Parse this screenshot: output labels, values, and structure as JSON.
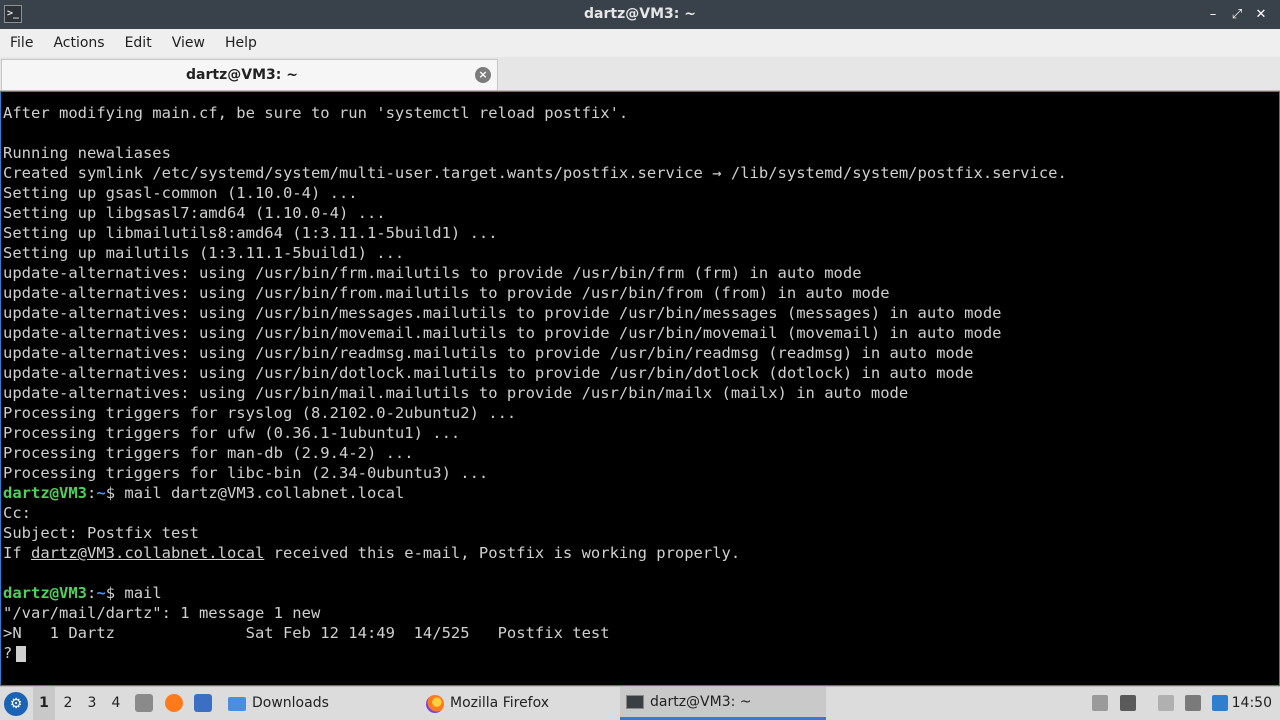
{
  "window": {
    "title": "dartz@VM3: ~",
    "buttons": {
      "minimize": "–",
      "maximize": "⤢",
      "close": "✕"
    }
  },
  "menu": [
    "File",
    "Actions",
    "Edit",
    "View",
    "Help"
  ],
  "tab": {
    "label": "dartz@VM3: ~",
    "close": "×"
  },
  "terminal": {
    "lines": [
      {
        "text": "After modifying main.cf, be sure to run 'systemctl reload postfix'."
      },
      {
        "text": ""
      },
      {
        "text": "Running newaliases"
      },
      {
        "text": "Created symlink /etc/systemd/system/multi-user.target.wants/postfix.service → /lib/systemd/system/postfix.service."
      },
      {
        "text": "Setting up gsasl-common (1.10.0-4) ..."
      },
      {
        "text": "Setting up libgsasl7:amd64 (1.10.0-4) ..."
      },
      {
        "text": "Setting up libmailutils8:amd64 (1:3.11.1-5build1) ..."
      },
      {
        "text": "Setting up mailutils (1:3.11.1-5build1) ..."
      },
      {
        "text": "update-alternatives: using /usr/bin/frm.mailutils to provide /usr/bin/frm (frm) in auto mode"
      },
      {
        "text": "update-alternatives: using /usr/bin/from.mailutils to provide /usr/bin/from (from) in auto mode"
      },
      {
        "text": "update-alternatives: using /usr/bin/messages.mailutils to provide /usr/bin/messages (messages) in auto mode"
      },
      {
        "text": "update-alternatives: using /usr/bin/movemail.mailutils to provide /usr/bin/movemail (movemail) in auto mode"
      },
      {
        "text": "update-alternatives: using /usr/bin/readmsg.mailutils to provide /usr/bin/readmsg (readmsg) in auto mode"
      },
      {
        "text": "update-alternatives: using /usr/bin/dotlock.mailutils to provide /usr/bin/dotlock (dotlock) in auto mode"
      },
      {
        "text": "update-alternatives: using /usr/bin/mail.mailutils to provide /usr/bin/mailx (mailx) in auto mode"
      },
      {
        "text": "Processing triggers for rsyslog (8.2102.0-2ubuntu2) ..."
      },
      {
        "text": "Processing triggers for ufw (0.36.1-1ubuntu1) ..."
      },
      {
        "text": "Processing triggers for man-db (2.9.4-2) ..."
      },
      {
        "text": "Processing triggers for libc-bin (2.34-0ubuntu3) ..."
      }
    ],
    "prompt_user": "dartz@VM3",
    "prompt_path": "~",
    "prompt_sep": ":",
    "prompt_sign": "$",
    "cmd1": " mail dartz@VM3.collabnet.local",
    "cc_line": "Cc:",
    "subject_line": "Subject: Postfix test",
    "body_prefix": "If ",
    "body_address": "dartz@VM3.collabnet.local",
    "body_suffix": " received this e-mail, Postfix is working properly.",
    "blank": "",
    "cmd2": " mail",
    "mailbox_line": "\"/var/mail/dartz\": 1 message 1 new",
    "message_line": ">N   1 Dartz              Sat Feb 12 14:49  14/525   Postfix test",
    "input_prompt": "?"
  },
  "taskbar": {
    "workspaces": [
      "1",
      "2",
      "3",
      "4"
    ],
    "tasks": [
      {
        "label": "Downloads",
        "icon": "folder-icon"
      },
      {
        "label": "Mozilla Firefox",
        "icon": "firefox-icon"
      },
      {
        "label": "dartz@VM3: ~",
        "icon": "terminal-icon"
      }
    ],
    "clock": "14:50",
    "colors": {
      "accent": "#2f7fd1",
      "prompt": "#4fd05a",
      "path": "#4f8ef7"
    }
  }
}
